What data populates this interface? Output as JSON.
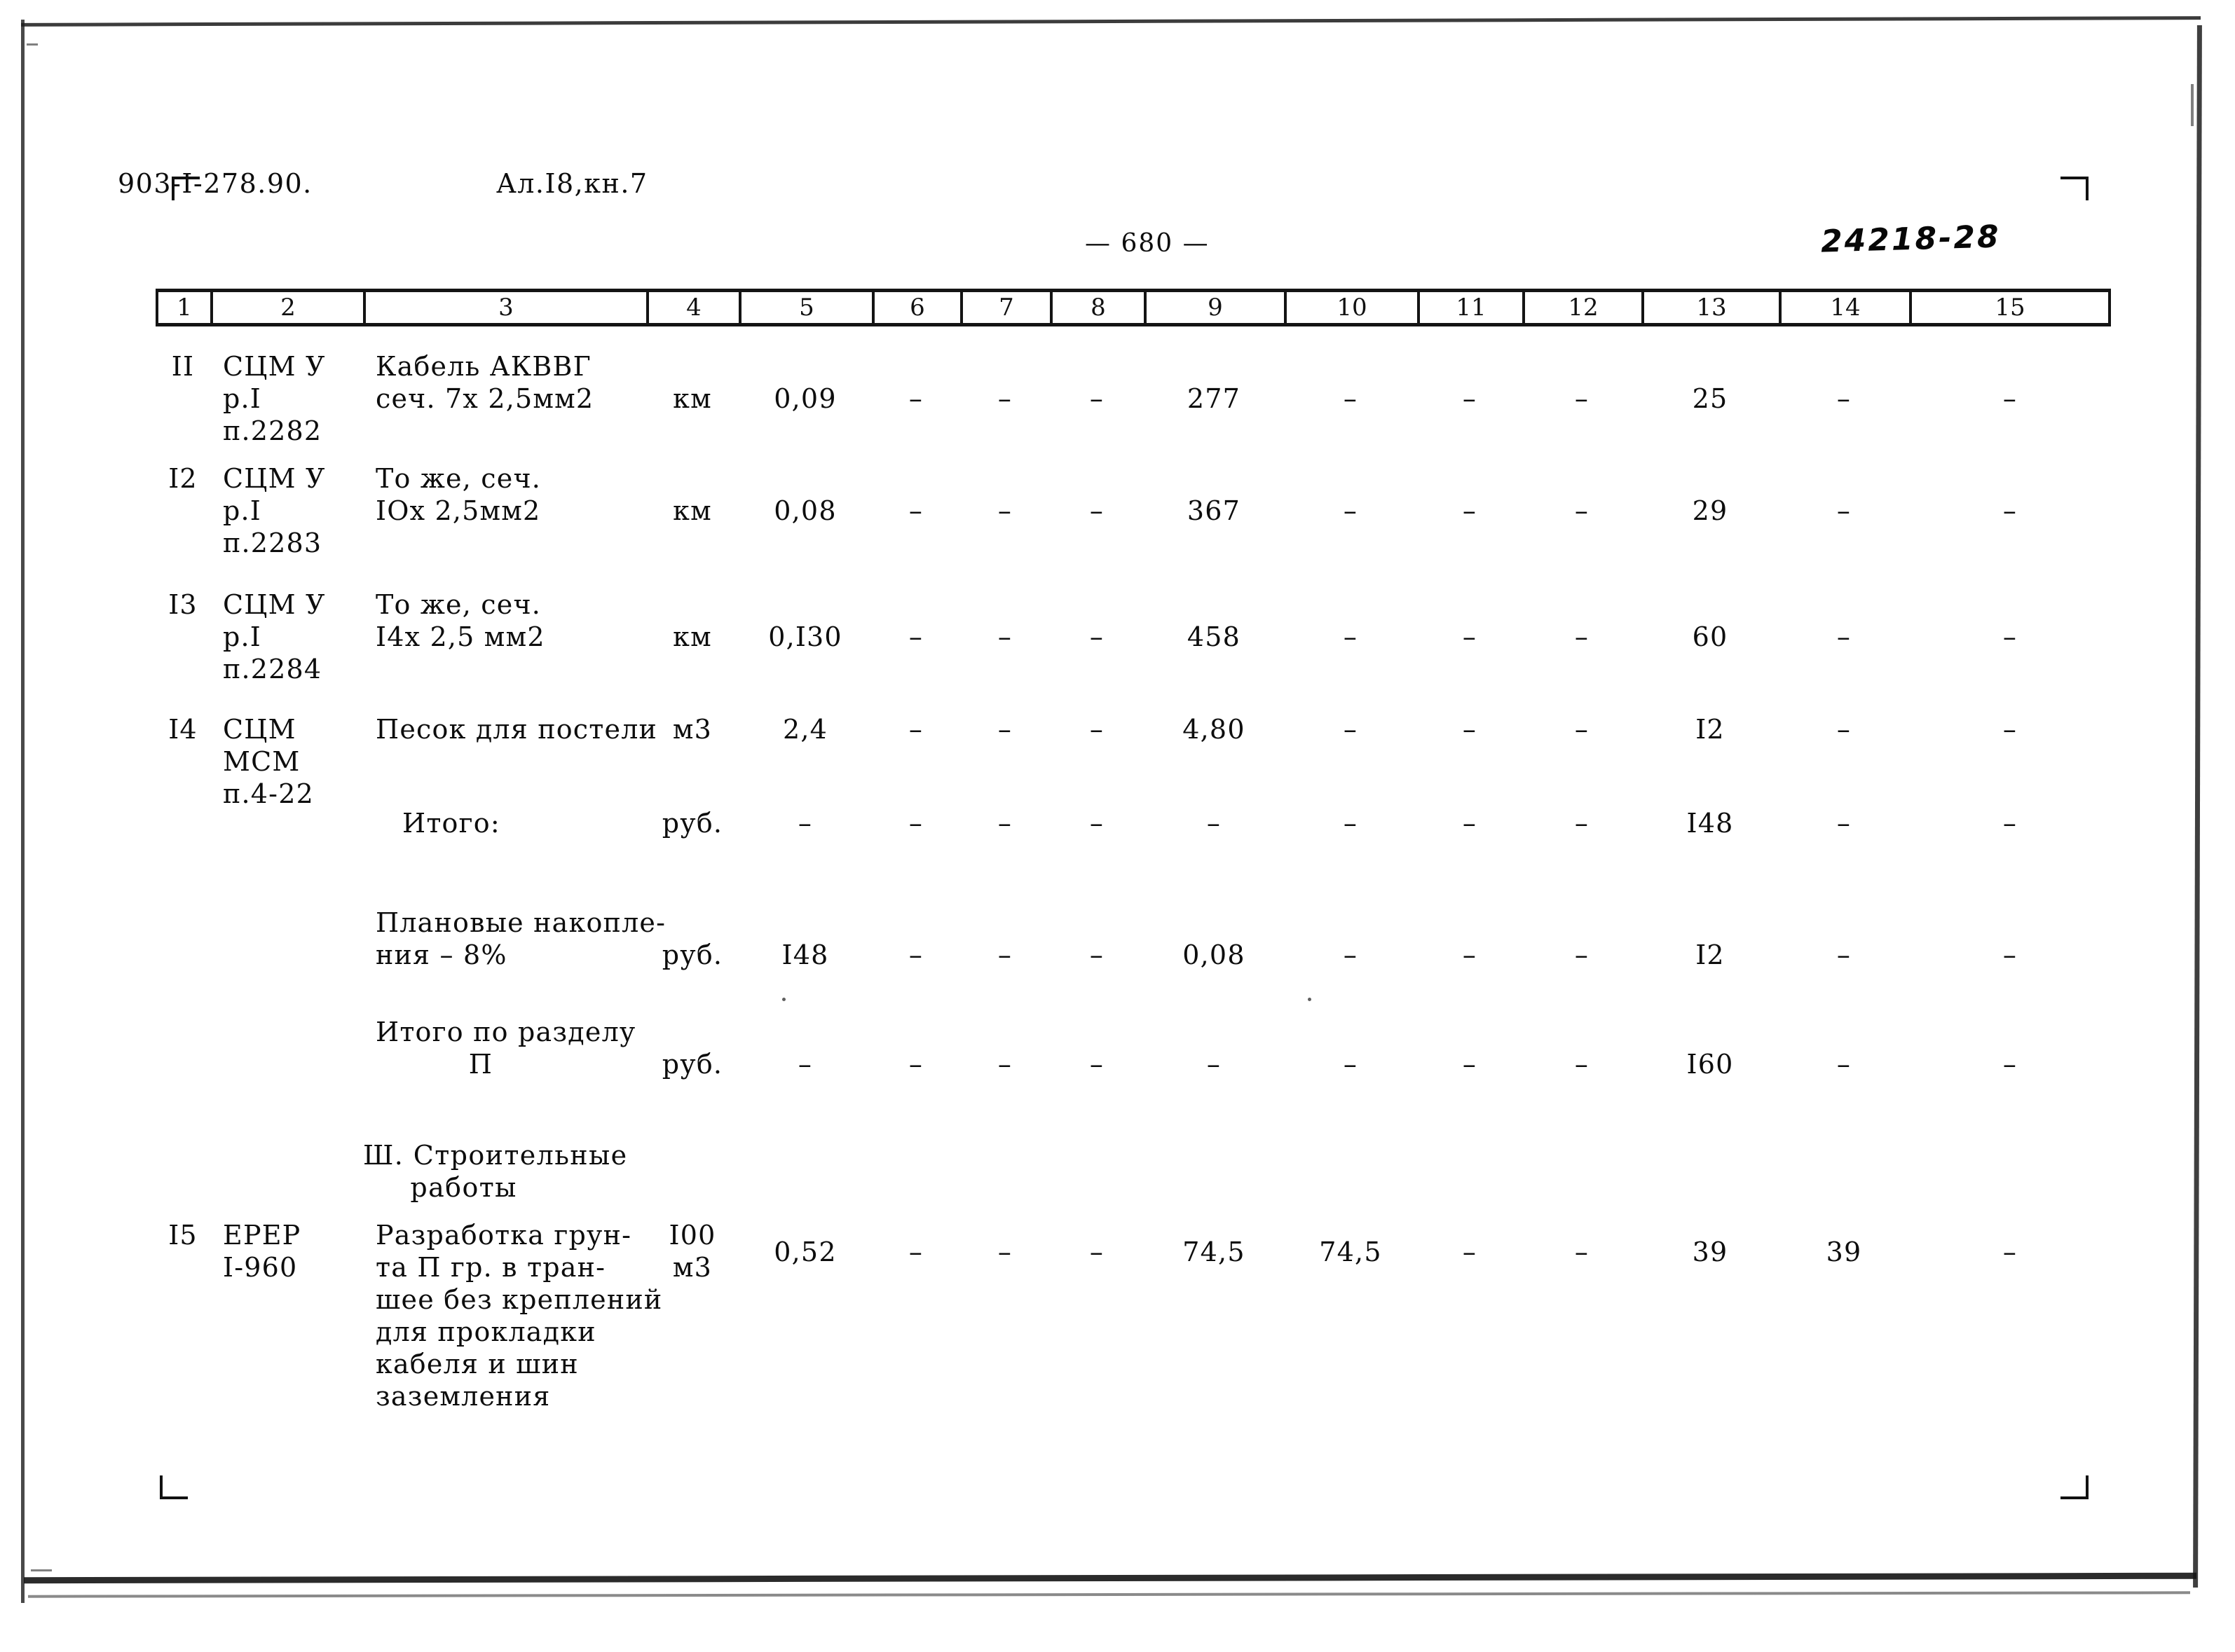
{
  "header": {
    "doc_code": "903-I-278.90.",
    "album_ref": "Ал.I8,кн.7",
    "page_number": "— 680 —",
    "archive_code": "24218-28"
  },
  "table": {
    "column_headers": [
      "1",
      "2",
      "3",
      "4",
      "5",
      "6",
      "7",
      "8",
      "9",
      "10",
      "11",
      "12",
      "13",
      "14",
      "15"
    ],
    "rows": [
      {
        "no": "II",
        "code": "СЦМ У\nр.I\nп.2282",
        "name": "Кабель АКВВГ\nсеч. 7х 2,5мм2",
        "unit": "км",
        "c5": "0,09",
        "c6": "–",
        "c7": "–",
        "c8": "–",
        "c9": "277",
        "c10": "–",
        "c11": "–",
        "c12": "–",
        "c13": "25",
        "c14": "–",
        "c15": "–"
      },
      {
        "no": "I2",
        "code": "СЦМ У\nр.I\nп.2283",
        "name": "То же, сеч.\nIОх 2,5мм2",
        "unit": "км",
        "c5": "0,08",
        "c6": "–",
        "c7": "–",
        "c8": "–",
        "c9": "367",
        "c10": "–",
        "c11": "–",
        "c12": "–",
        "c13": "29",
        "c14": "–",
        "c15": "–"
      },
      {
        "no": "I3",
        "code": "СЦМ У\nр.I\nп.2284",
        "name": "То же, сеч.\nI4х 2,5 мм2",
        "unit": "км",
        "c5": "0,I30",
        "c6": "–",
        "c7": "–",
        "c8": "–",
        "c9": "458",
        "c10": "–",
        "c11": "–",
        "c12": "–",
        "c13": "60",
        "c14": "–",
        "c15": "–"
      },
      {
        "no": "I4",
        "code": "СЦМ\nМСМ\nп.4-22",
        "name": "Песок для постели",
        "unit": "м3",
        "c5": "2,4",
        "c6": "–",
        "c7": "–",
        "c8": "–",
        "c9": "4,80",
        "c10": "–",
        "c11": "–",
        "c12": "–",
        "c13": "I2",
        "c14": "–",
        "c15": "–"
      },
      {
        "no": "",
        "code": "",
        "name": "Итого:",
        "unit": "руб.",
        "c5": "–",
        "c6": "–",
        "c7": "–",
        "c8": "–",
        "c9": "–",
        "c10": "–",
        "c11": "–",
        "c12": "–",
        "c13": "I48",
        "c14": "–",
        "c15": "–"
      },
      {
        "no": "",
        "code": "",
        "name": "Плановые накопле-\nния – 8%",
        "unit": "руб.",
        "c5": "I48",
        "c6": "–",
        "c7": "–",
        "c8": "–",
        "c9": "0,08",
        "c10": "–",
        "c11": "–",
        "c12": "–",
        "c13": "I2",
        "c14": "–",
        "c15": "–"
      },
      {
        "no": "",
        "code": "",
        "name": "Итого по разделу\n          П",
        "unit": "руб.",
        "c5": "–",
        "c6": "–",
        "c7": "–",
        "c8": "–",
        "c9": "–",
        "c10": "–",
        "c11": "–",
        "c12": "–",
        "c13": "I60",
        "c14": "–",
        "c15": "–"
      },
      {
        "no": "I5",
        "code": "ЕРЕР\nI-960",
        "name": "Разработка грун-\nта П гр. в тран-\nшее без креплений\nдля прокладки\nкабеля и шин\nзаземления",
        "unit": "I00\nм3",
        "c5": "0,52",
        "c6": "–",
        "c7": "–",
        "c8": "–",
        "c9": "74,5",
        "c10": "74,5",
        "c11": "–",
        "c12": "–",
        "c13": "39",
        "c14": "39",
        "c15": "–"
      }
    ],
    "section_heading": "Ш. Строительные\n     работы"
  }
}
